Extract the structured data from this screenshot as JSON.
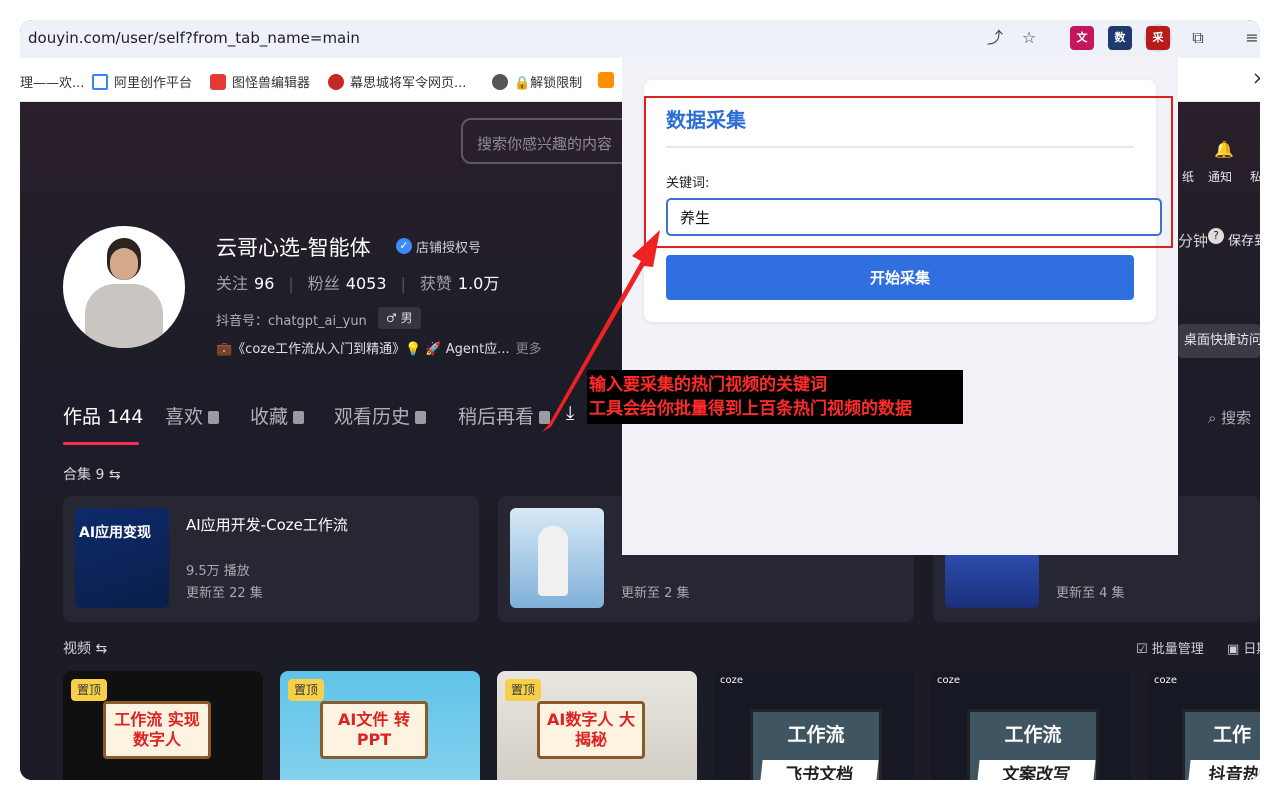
{
  "browser": {
    "url": "douyin.com/user/self?from_tab_name=main",
    "bookmarks": [
      "理——欢...",
      "阿里创作平台",
      "图怪兽编辑器",
      "幕思城将军令网页...",
      "🔒解锁限制",
      "淘"
    ],
    "close_glyph": "×"
  },
  "profile": {
    "search_placeholder": "搜索你感兴趣的内容",
    "name": "云哥心选-智能体",
    "verified_label": "店铺授权号",
    "follow_label": "关注",
    "follow_count": "96",
    "fans_label": "粉丝",
    "fans_count": "4053",
    "likes_label": "获赞",
    "likes_count": "1.0万",
    "douyin_id": "抖音号：chatgpt_ai_yun",
    "gender": "♂ 男",
    "bio": "💼《coze工作流从入门到精通》💡 🚀 Agent应...",
    "bio_more": "更多"
  },
  "header_right": {
    "wallpaper_frag": "纸",
    "notify": "通知",
    "private_frag": "私",
    "minute_frag": "分钟",
    "save_frag": "保存到",
    "desktop": "桌面快捷访问"
  },
  "tabs": [
    {
      "label": "作品 144"
    },
    {
      "label": "喜欢"
    },
    {
      "label": "收藏"
    },
    {
      "label": "观看历史"
    },
    {
      "label": "稍后再看"
    }
  ],
  "tab_search": "搜索",
  "collections": {
    "label": "合集 9",
    "items": [
      {
        "title": "AI应用开发-Coze工作流",
        "plays": "9.5万 播放",
        "update": "更新至 22 集",
        "thumb_text": "AI应用变现"
      },
      {
        "title": "",
        "plays": "",
        "update": "更新至 2 集",
        "thumb_text": ""
      },
      {
        "title": "",
        "plays": "",
        "update": "更新至 4 集",
        "thumb_text": ""
      }
    ]
  },
  "videos": {
    "label": "视频",
    "batch": "批量管理",
    "date_frag": "日期",
    "items": [
      {
        "pin": "置顶",
        "title": "工作流 实现数字人"
      },
      {
        "pin": "置顶",
        "title": "AI文件 转PPT"
      },
      {
        "pin": "置顶",
        "title": "AI数字人 大揭秘"
      },
      {
        "tag": "coze",
        "t1": "工作流",
        "t2": "飞书文档"
      },
      {
        "tag": "coze",
        "t1": "工作流",
        "t2": "文案改写"
      },
      {
        "tag": "coze",
        "t1": "工作",
        "t2": "抖音热"
      }
    ]
  },
  "popup": {
    "title": "数据采集",
    "keyword_label": "关键词:",
    "keyword_value": "养生",
    "start_button": "开始采集"
  },
  "annotation": {
    "line1": "输入要采集的热门视频的关键词",
    "line2": "工具会给你批量得到上百条热门视频的数据"
  },
  "colors": {
    "accent_blue": "#2f6fdf",
    "annotation_red": "#ff2a2a",
    "douyin_red": "#fe2c55"
  }
}
